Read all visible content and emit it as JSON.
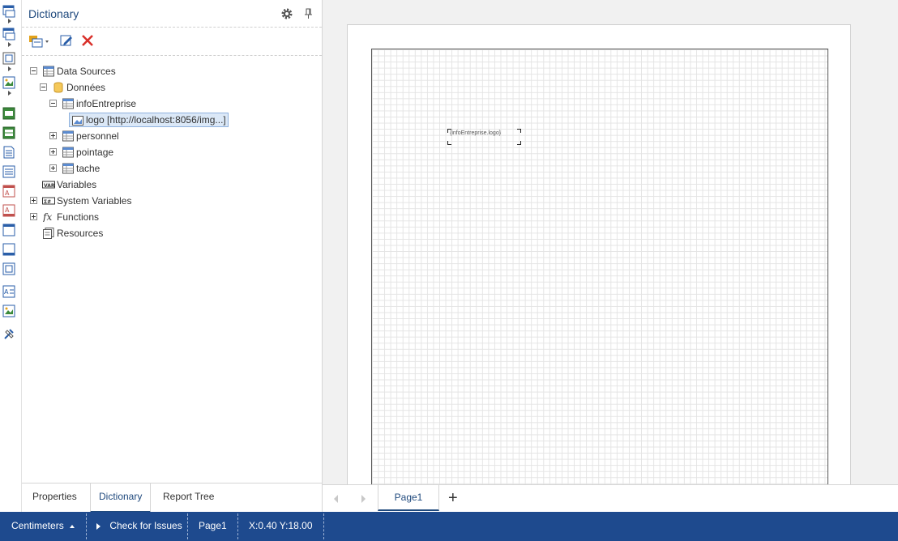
{
  "dictionary": {
    "title": "Dictionary",
    "settings_icon": "gear-icon",
    "pin_icon": "pin-icon",
    "toolbar": {
      "new_item": "new-item-dropdown-icon",
      "edit": "edit-icon",
      "delete": "delete-icon"
    },
    "tree": {
      "data_sources": "Data Sources",
      "donnees": "Données",
      "info_entreprise": "infoEntreprise",
      "logo": "logo [http://localhost:8056/img...]",
      "personnel": "personnel",
      "pointage": "pointage",
      "tache": "tache",
      "variables": "Variables",
      "system_variables": "System Variables",
      "functions": "Functions",
      "resources": "Resources"
    },
    "tabs": {
      "properties": "Properties",
      "dictionary": "Dictionary",
      "report_tree": "Report Tree"
    }
  },
  "designer": {
    "component_text": "{infoEntreprise.logo}",
    "page_tab": "Page1",
    "add_page": "+"
  },
  "status": {
    "units": "Centimeters",
    "check_issues": "Check for Issues",
    "page": "Page1",
    "coords": "X:0.40 Y:18.00"
  },
  "colors": {
    "accent": "#1f497d",
    "statusbar": "#1e4a8e"
  }
}
